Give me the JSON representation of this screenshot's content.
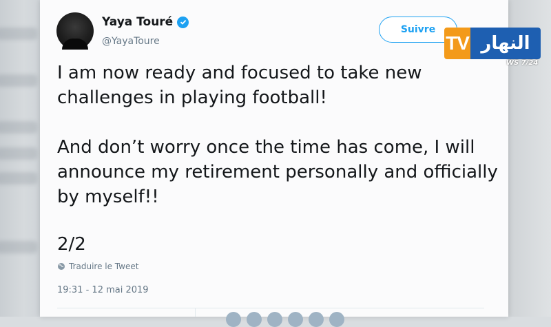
{
  "tweet": {
    "author_name": "Yaya Touré",
    "handle": "@YayaToure",
    "follow_label": "Suivre",
    "paragraph_1": "I am now ready and focused to take new challenges in playing football!",
    "paragraph_2": "And don’t worry once the time has come, I will announce my retirement personally and officially by myself!!",
    "counter": "2/2",
    "translate_label": "Traduire le Tweet",
    "timestamp": "19:31 - 12 mai 2019"
  },
  "overlay": {
    "tv_badge": "TV",
    "channel_name": "النهار",
    "ticker": "WS 7/24"
  },
  "icons": {
    "verified": "verified-badge-icon",
    "globe": "globe-icon"
  },
  "colors": {
    "twitter_blue": "#1da1f2",
    "channel_orange": "#f39a1a",
    "channel_blue": "#1e5fb1"
  }
}
